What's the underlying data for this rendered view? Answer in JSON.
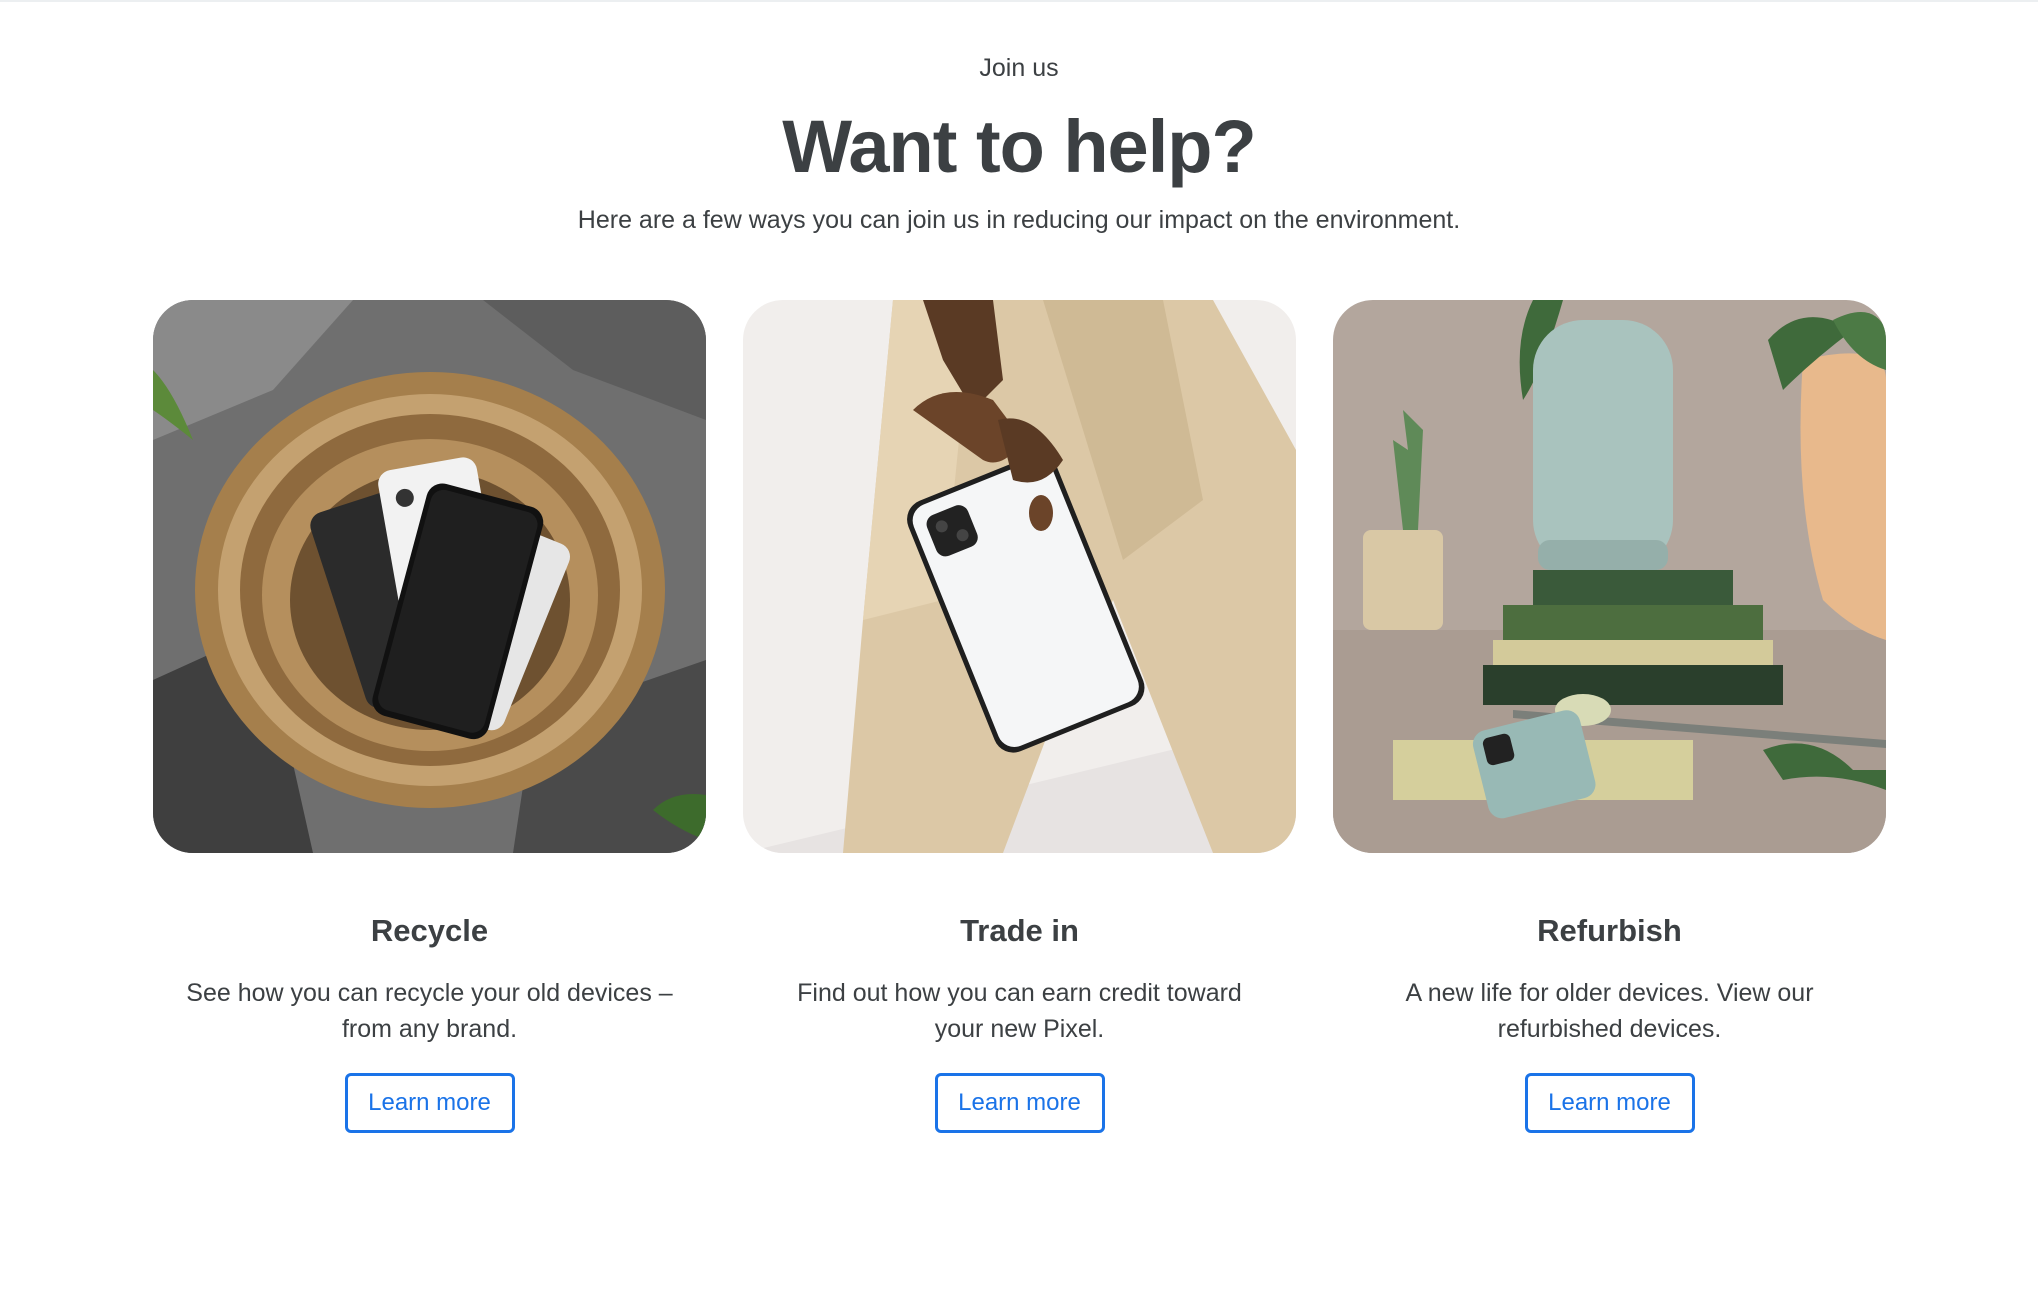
{
  "section": {
    "eyebrow": "Join us",
    "title": "Want to help?",
    "subtitle": "Here are a few ways you can join us in reducing our impact on the environment."
  },
  "cards": [
    {
      "title": "Recycle",
      "description": "See how you can recycle your old devices – from any brand.",
      "button_label": "Learn more",
      "image": "wicker basket containing old phones"
    },
    {
      "title": "Trade in",
      "description": "Find out how you can earn credit toward your new Pixel.",
      "button_label": "Learn more",
      "image": "hand holding a white Pixel phone"
    },
    {
      "title": "Refurbish",
      "description": "A new life for older devices. View our refurbished devices.",
      "button_label": "Learn more",
      "image": "smart speaker on stacked books with phone and plants"
    }
  ],
  "colors": {
    "text": "#3c4043",
    "accent": "#1a73e8",
    "background": "#ffffff"
  }
}
